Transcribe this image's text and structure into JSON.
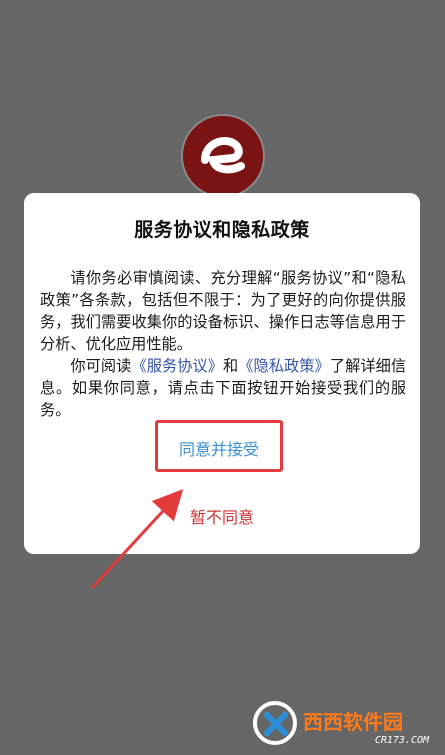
{
  "dialog": {
    "title": "服务协议和隐私政策",
    "para1": "请你务必审慎阅读、充分理解“服务协议”和“隐私政策”各条款，包括但不限于：为了更好的向你提供服务，我们需要收集你的设备标识、操作日志等信息用于分析、优化应用性能。",
    "para2_prefix": "你可阅读",
    "link_service": "《服务协议》",
    "para2_and": "和",
    "link_privacy": "《隐私政策》",
    "para2_suffix": "了解详细信息。如果你同意，请点击下面按钮开始接受我们的服务。",
    "agree_label": "同意并接受",
    "disagree_label": "暂不同意"
  },
  "watermark": {
    "text": "西西软件园",
    "site": "CR173.COM"
  },
  "colors": {
    "background_overlay": "#666666",
    "dialog_background": "#ffffff",
    "link": "#3455a8",
    "agree": "#3b8fd1",
    "disagree": "#cc3333",
    "highlight_box": "#e23b3b",
    "logo": "#7a1414"
  }
}
